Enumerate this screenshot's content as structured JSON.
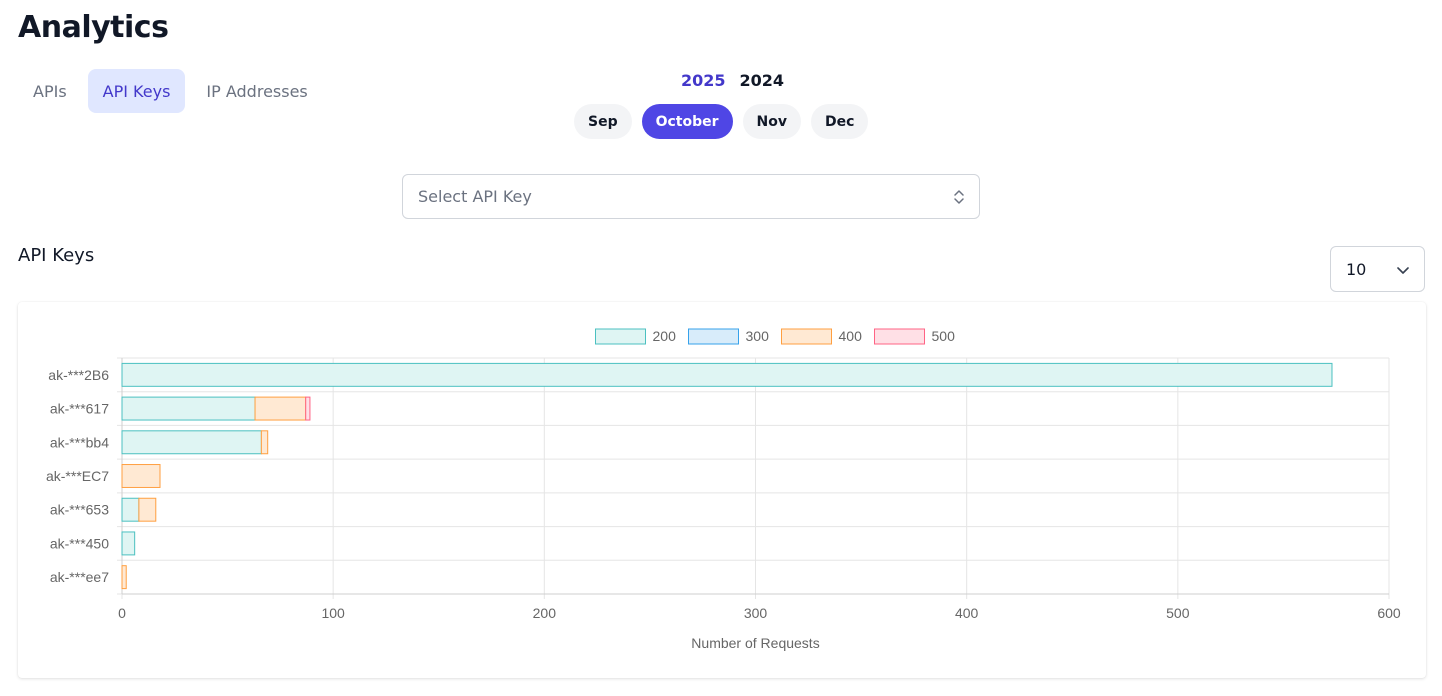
{
  "page": {
    "title": "Analytics"
  },
  "tabs": [
    {
      "label": "APIs",
      "active": false
    },
    {
      "label": "API Keys",
      "active": true
    },
    {
      "label": "IP Addresses",
      "active": false
    }
  ],
  "years": [
    {
      "label": "2025",
      "active": true
    },
    {
      "label": "2024",
      "active": false
    }
  ],
  "months": [
    {
      "label": "Sep",
      "active": false
    },
    {
      "label": "October",
      "active": true
    },
    {
      "label": "Nov",
      "active": false
    },
    {
      "label": "Dec",
      "active": false
    }
  ],
  "api_key_select": {
    "placeholder": "Select API Key",
    "icon": "updown-chevron-icon"
  },
  "section": {
    "title": "API Keys"
  },
  "page_size": {
    "value": "10",
    "icon": "chevron-down-icon"
  },
  "colors": {
    "accent": "#4f46e5",
    "tab_active_bg": "#e0e7ff",
    "s200": {
      "fill": "#dff5f3",
      "stroke": "#4bc0c0"
    },
    "s300": {
      "fill": "#d8ecfa",
      "stroke": "#36a2eb"
    },
    "s400": {
      "fill": "#ffe9d3",
      "stroke": "#ff9f40"
    },
    "s500": {
      "fill": "#ffe0e6",
      "stroke": "#ff6384"
    }
  },
  "chart_data": {
    "type": "bar",
    "orientation": "horizontal",
    "stacked": true,
    "categories": [
      "ak-***2B6",
      "ak-***617",
      "ak-***bb4",
      "ak-***EC7",
      "ak-***653",
      "ak-***450",
      "ak-***ee7"
    ],
    "series": [
      {
        "name": "200",
        "values": [
          573,
          63,
          66,
          0,
          8,
          6,
          0
        ]
      },
      {
        "name": "300",
        "values": [
          0,
          0,
          0,
          0,
          0,
          0,
          0
        ]
      },
      {
        "name": "400",
        "values": [
          0,
          24,
          3,
          18,
          8,
          0,
          2
        ]
      },
      {
        "name": "500",
        "values": [
          0,
          2,
          0,
          0,
          0,
          0,
          0
        ]
      }
    ],
    "xlabel": "Number of Requests",
    "ylabel": "",
    "xlim": [
      0,
      600
    ],
    "xticks": [
      0,
      100,
      200,
      300,
      400,
      500,
      600
    ],
    "grid": true,
    "legend_position": "top"
  }
}
